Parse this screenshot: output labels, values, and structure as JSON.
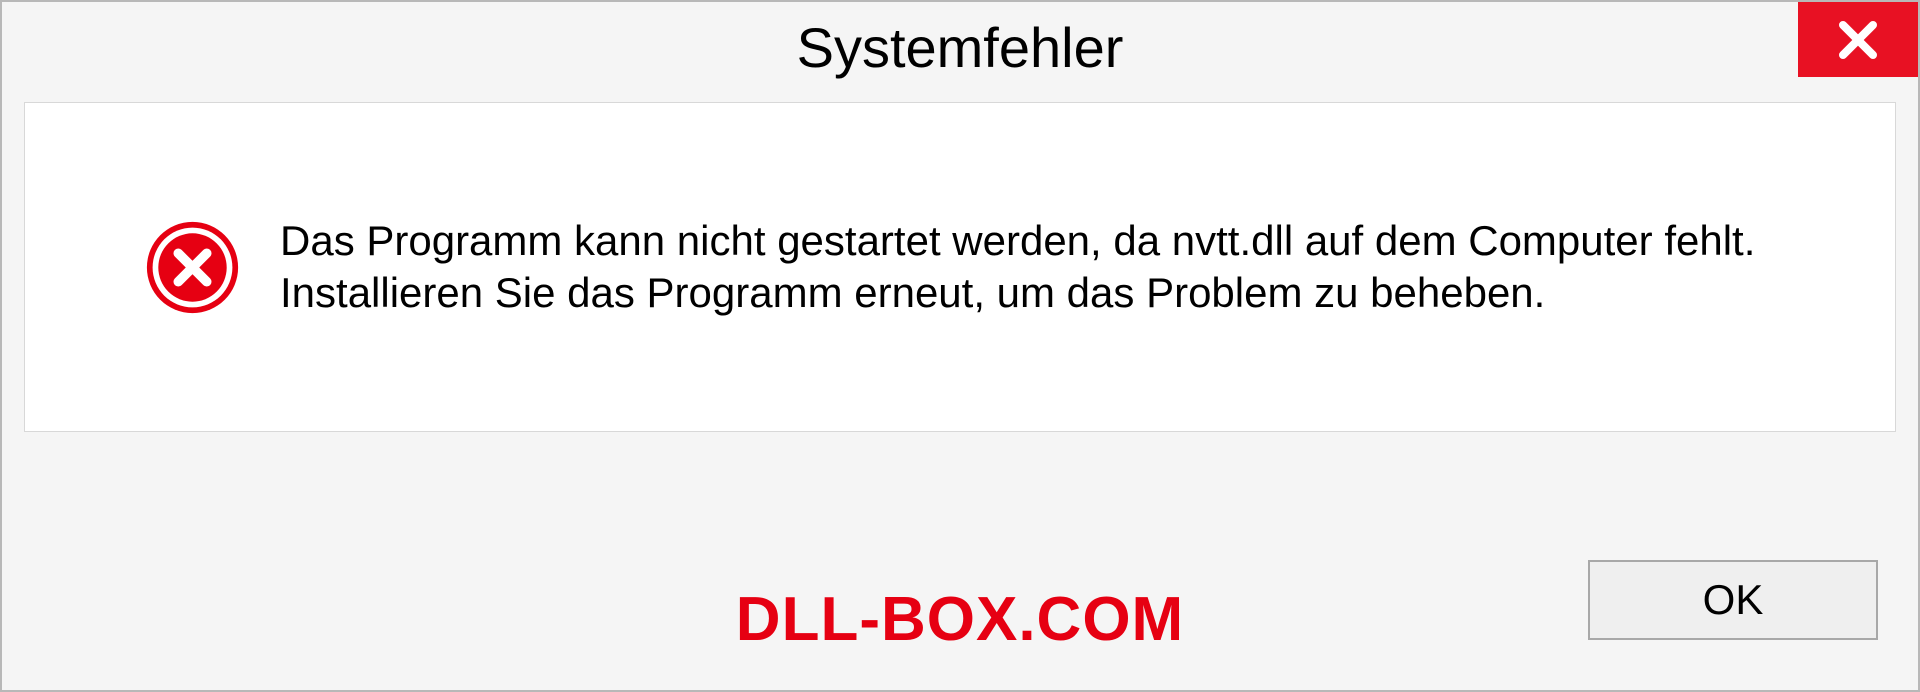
{
  "dialog": {
    "title": "Systemfehler",
    "message": "Das Programm kann nicht gestartet werden, da nvtt.dll auf dem Computer fehlt. Installieren Sie das Programm erneut, um das Problem zu beheben.",
    "ok_label": "OK"
  },
  "watermark": "DLL-BOX.COM"
}
